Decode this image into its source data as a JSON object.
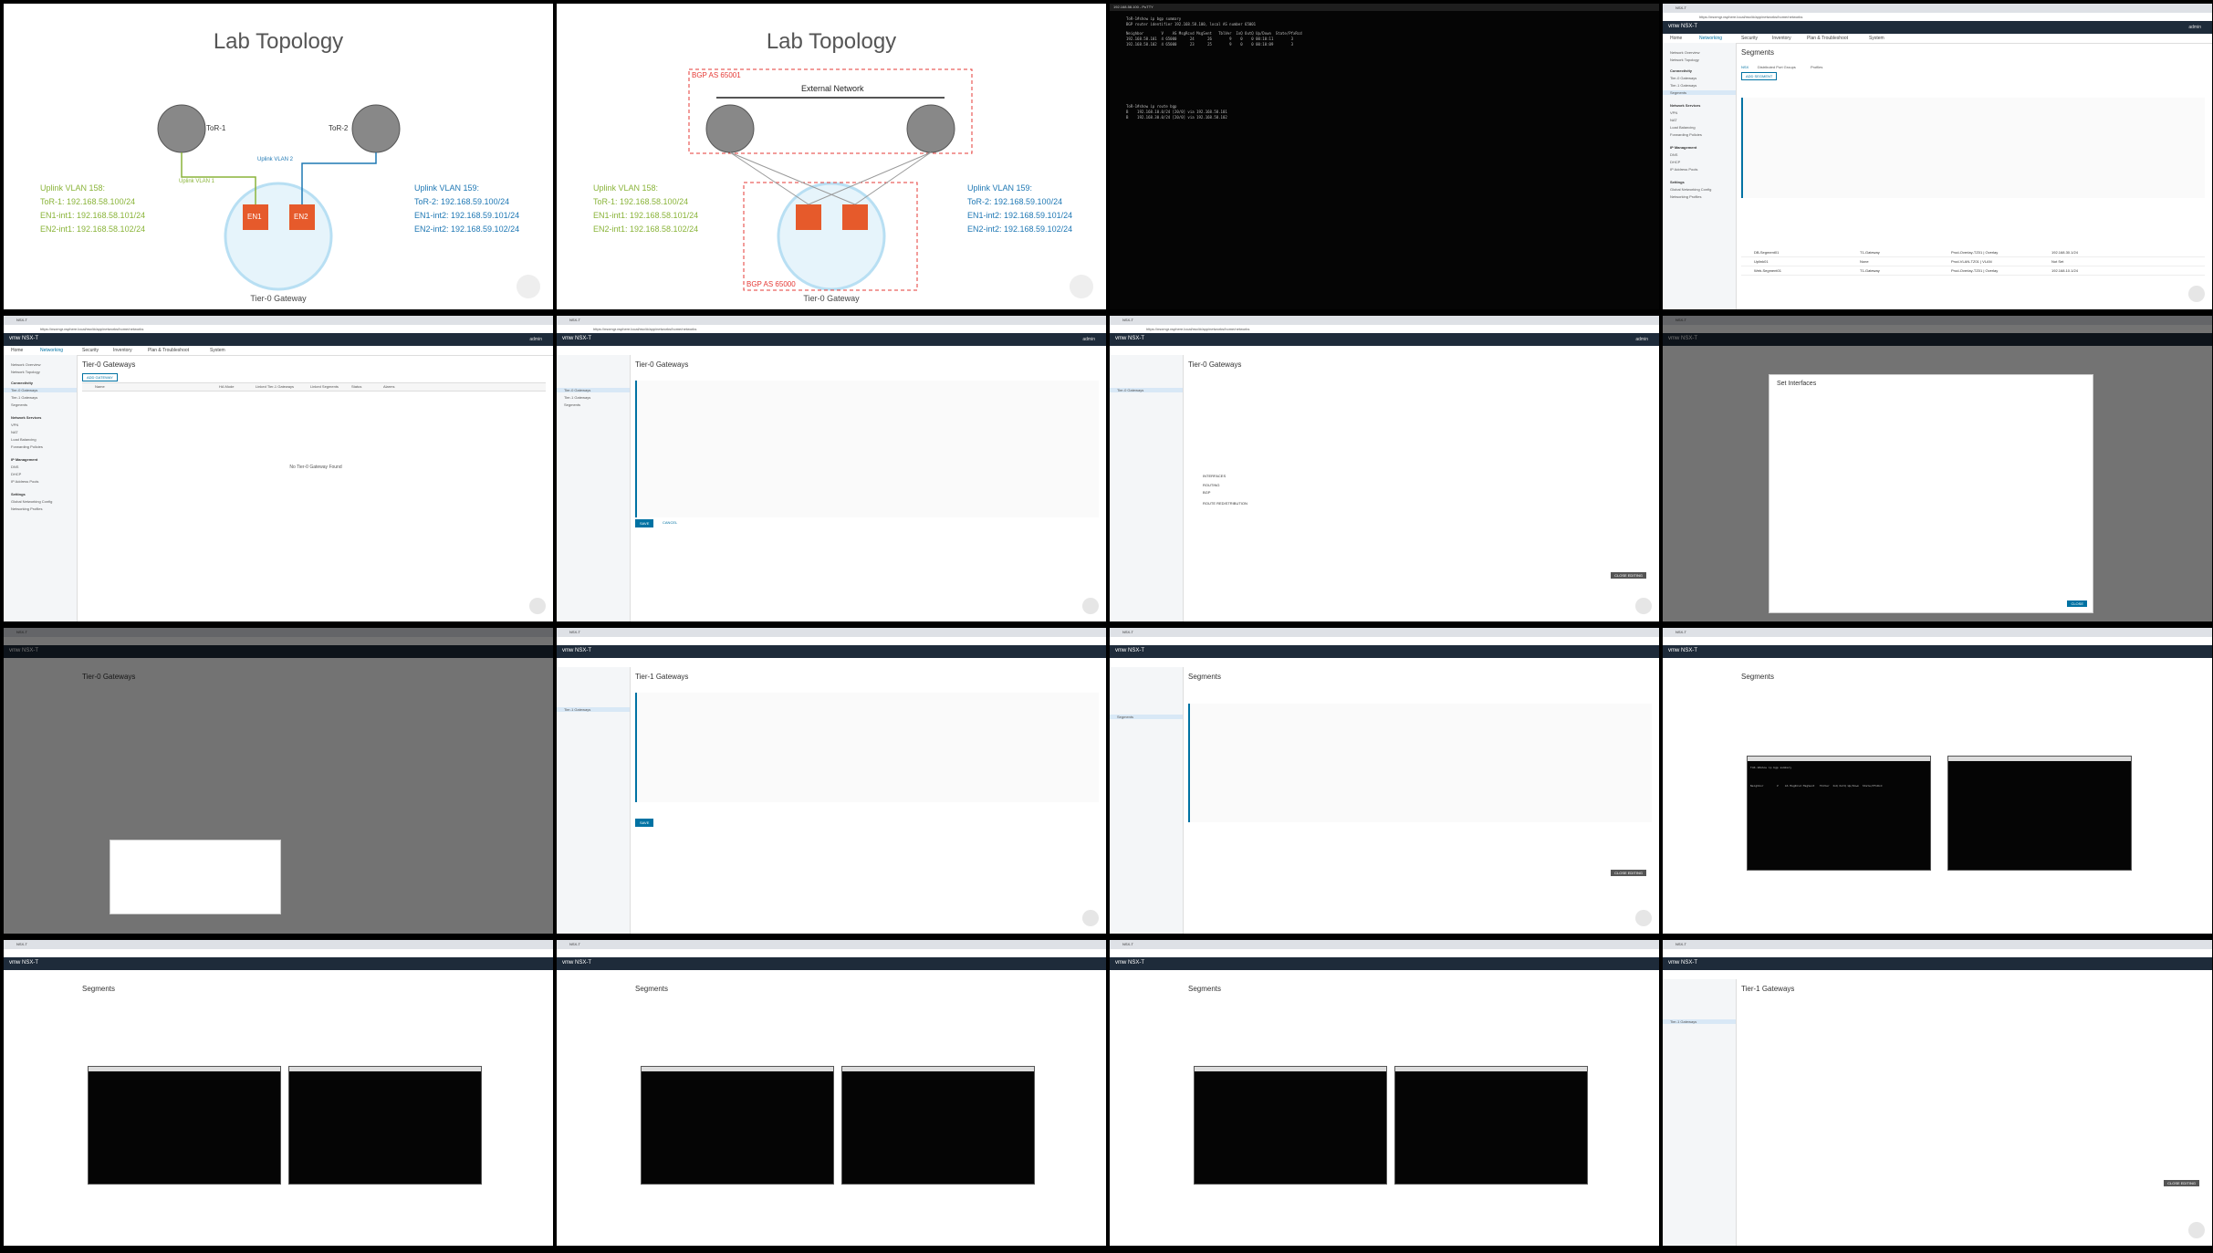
{
  "slide1": {
    "title": "Lab Topology",
    "tor1": "ToR-1",
    "tor2": "ToR-2",
    "uplink_vlan2": "Uplink VLAN 2",
    "uplink_vlan1": "Uplink VLAN 1",
    "en1": "EN1",
    "en2": "EN2",
    "caption": "Tier-0 Gateway",
    "left_lines": [
      "Uplink VLAN 158:",
      "ToR-1: 192.168.58.100/24",
      "EN1-int1: 192.168.58.101/24",
      "EN2-int1: 192.168.58.102/24"
    ],
    "right_lines": [
      "Uplink VLAN 159:",
      "ToR-2: 192.168.59.100/24",
      "EN1-int2: 192.168.59.101/24",
      "EN2-int2: 192.168.59.102/24"
    ]
  },
  "slide2": {
    "title": "Lab Topology",
    "bgp_top": "BGP AS 65001",
    "external": "External Network",
    "bgp_bottom": "BGP AS 65000"
  },
  "ui": {
    "tab_title": "NSX-T",
    "url": "https://nsxmgr.vsphere.local/nsx/#/app/networks/home/networks",
    "logo": "vmw NSX-T",
    "user": "admin",
    "nav": [
      "Home",
      "Networking",
      "Security",
      "Inventory",
      "Plan & Troubleshoot",
      "System"
    ],
    "sidebar": [
      "Network Overview",
      "Network Topology",
      "Connectivity",
      "Tier-0 Gateways",
      "Tier-1 Gateways",
      "Segments",
      "Network Services",
      "VPN",
      "NAT",
      "Load Balancing",
      "Forwarding Policies",
      "IP Management",
      "DNS",
      "DHCP",
      "IP Address Pools",
      "Settings",
      "Global Networking Config",
      "Networking Profiles"
    ],
    "tier0_title": "Tier-0 Gateways",
    "tier1_title": "Tier-1 Gateways",
    "segments_title": "Segments",
    "add_t0": "ADD GATEWAY",
    "add_segment": "ADD SEGMENT",
    "empty_t0": "No Tier-0 Gateway Found",
    "col_name": "Name",
    "col_ha": "HA Mode",
    "col_linked": "Linked Tier-1 Gateways",
    "col_routes": "Linked Segments",
    "col_status": "Status",
    "col_alarms": "Alarms",
    "col_connected": "Connected Gateway",
    "col_transport": "Transport Zone",
    "col_subnets": "Subnets",
    "seg_tabs": [
      "NSX",
      "Distributed Port Groups",
      "Profiles"
    ],
    "seg_rows": [
      {
        "name": "DB-Segment01",
        "gw": "T1-Gateway",
        "tz": "Prod-Overlay-TZ01 | Overlay",
        "subnet": "192.168.30.1/24",
        "status": "Success"
      },
      {
        "name": "Uplink01",
        "gw": "None",
        "tz": "Prod-VLAN-TZ01 | VLAN",
        "subnet": "Not Set",
        "status": "Success"
      },
      {
        "name": "Web-Segment01",
        "gw": "T1-Gateway",
        "tz": "Prod-Overlay-TZ01 | Overlay",
        "subnet": "192.168.10.1/24",
        "status": "Success"
      }
    ],
    "set_interfaces": "Set Interfaces",
    "close": "CLOSE",
    "close_editing": "CLOSE EDITING",
    "save": "SAVE",
    "cancel": "CANCEL",
    "interfaces": "INTERFACES",
    "bgp": "BGP",
    "routing": "ROUTING",
    "route_redistribution": "ROUTE REDISTRIBUTION"
  },
  "terminal": {
    "tab_title": "192.168.58.100 - PuTTY",
    "lines": [
      "ToR-1#show ip bgp summary",
      "BGP router identifier 192.168.58.100, local AS number 65001",
      "Neighbor        V    AS MsgRcvd MsgSent   TblVer  InQ OutQ Up/Down  State/PfxRcd",
      "192.168.58.101  4 65000      24      26        9    0    0 00:10:11        3",
      "192.168.58.102  4 65000      23      25        9    0    0 00:10:09        3",
      "ToR-1#show ip route bgp",
      "B    192.168.10.0/24 [20/0] via 192.168.58.101",
      "B    192.168.30.0/24 [20/0] via 192.168.58.102"
    ]
  }
}
